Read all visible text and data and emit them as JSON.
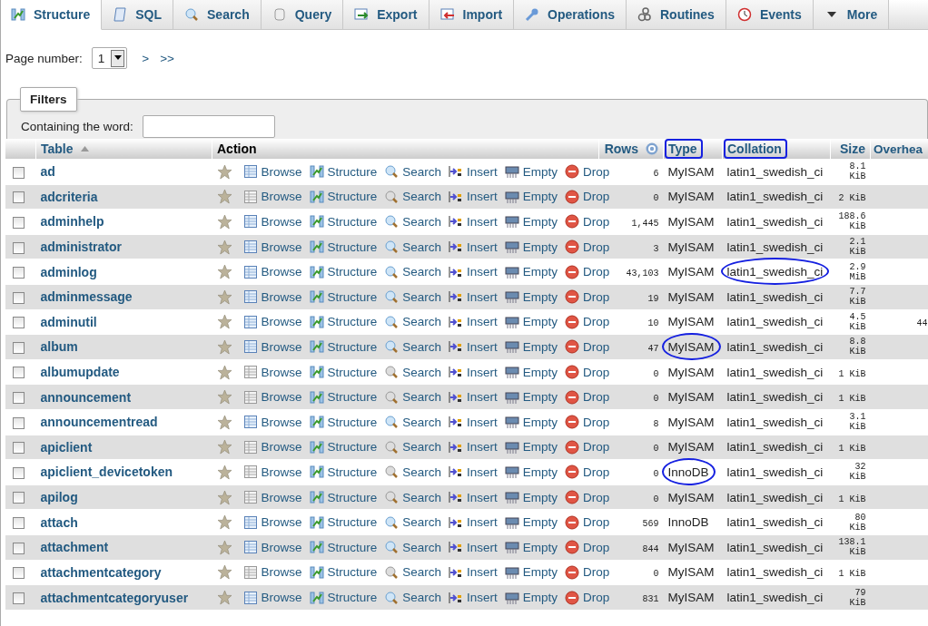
{
  "tabs": [
    {
      "label": "Structure",
      "selected": true
    },
    {
      "label": "SQL",
      "selected": false
    },
    {
      "label": "Search",
      "selected": false
    },
    {
      "label": "Query",
      "selected": false
    },
    {
      "label": "Export",
      "selected": false
    },
    {
      "label": "Import",
      "selected": false
    },
    {
      "label": "Operations",
      "selected": false
    },
    {
      "label": "Routines",
      "selected": false
    },
    {
      "label": "Events",
      "selected": false
    },
    {
      "label": "More",
      "selected": false
    }
  ],
  "pagination": {
    "label": "Page number:",
    "value": "1",
    "next": ">",
    "last": ">>"
  },
  "filters": {
    "legend": "Filters",
    "label": "Containing the word:"
  },
  "table": {
    "columns": [
      {
        "label": "Table",
        "circled": false
      },
      {
        "label": "Action",
        "circled": false
      },
      {
        "label": "Rows",
        "circled": false
      },
      {
        "label": "Type",
        "circled": true
      },
      {
        "label": "Collation",
        "circled": true
      },
      {
        "label": "Size",
        "circled": false
      },
      {
        "label": "Overhea",
        "circled": false
      }
    ],
    "rows": [
      {
        "name": "ad",
        "rows": "6",
        "type": "MyISAM",
        "collation": "latin1_swedish_ci",
        "size": "8.1 KiB",
        "checked": false,
        "empty": false,
        "actions": [
          "Browse",
          "Structure",
          "Search",
          "Insert",
          "Empty",
          "Drop"
        ]
      },
      {
        "name": "adcriteria",
        "rows": "0",
        "type": "MyISAM",
        "collation": "latin1_swedish_ci",
        "size": "2 KiB",
        "checked": false,
        "empty": true,
        "actions": [
          "Browse",
          "Structure",
          "Search",
          "Insert",
          "Empty",
          "Drop"
        ]
      },
      {
        "name": "adminhelp",
        "rows": "1,445",
        "type": "MyISAM",
        "collation": "latin1_swedish_ci",
        "size": "188.6 KiB",
        "checked": false,
        "empty": false,
        "actions": [
          "Browse",
          "Structure",
          "Search",
          "Insert",
          "Empty",
          "Drop"
        ]
      },
      {
        "name": "administrator",
        "rows": "3",
        "type": "MyISAM",
        "collation": "latin1_swedish_ci",
        "size": "2.1 KiB",
        "checked": false,
        "empty": false,
        "actions": [
          "Browse",
          "Structure",
          "Search",
          "Insert",
          "Empty",
          "Drop"
        ]
      },
      {
        "name": "adminlog",
        "rows": "43,103",
        "type": "MyISAM",
        "collation": "latin1_swedish_ci",
        "size": "2.9 MiB",
        "checked": false,
        "empty": false,
        "collation_circled": true,
        "actions": [
          "Browse",
          "Structure",
          "Search",
          "Insert",
          "Empty",
          "Drop"
        ]
      },
      {
        "name": "adminmessage",
        "rows": "19",
        "type": "MyISAM",
        "collation": "latin1_swedish_ci",
        "size": "7.7 KiB",
        "checked": false,
        "empty": false,
        "actions": [
          "Browse",
          "Structure",
          "Search",
          "Insert",
          "Empty",
          "Drop"
        ]
      },
      {
        "name": "adminutil",
        "rows": "10",
        "type": "MyISAM",
        "collation": "latin1_swedish_ci",
        "size": "4.5 KiB",
        "overhead": "44",
        "checked": false,
        "empty": false,
        "actions": [
          "Browse",
          "Structure",
          "Search",
          "Insert",
          "Empty",
          "Drop"
        ]
      },
      {
        "name": "album",
        "rows": "47",
        "type": "MyISAM",
        "collation": "latin1_swedish_ci",
        "size": "8.8 KiB",
        "checked": false,
        "empty": false,
        "type_circled": true,
        "actions": [
          "Browse",
          "Structure",
          "Search",
          "Insert",
          "Empty",
          "Drop"
        ]
      },
      {
        "name": "albumupdate",
        "rows": "0",
        "type": "MyISAM",
        "collation": "latin1_swedish_ci",
        "size": "1 KiB",
        "checked": false,
        "empty": true,
        "actions": [
          "Browse",
          "Structure",
          "Search",
          "Insert",
          "Empty",
          "Drop"
        ]
      },
      {
        "name": "announcement",
        "rows": "0",
        "type": "MyISAM",
        "collation": "latin1_swedish_ci",
        "size": "1 KiB",
        "checked": false,
        "empty": true,
        "actions": [
          "Browse",
          "Structure",
          "Search",
          "Insert",
          "Empty",
          "Drop"
        ]
      },
      {
        "name": "announcementread",
        "rows": "8",
        "type": "MyISAM",
        "collation": "latin1_swedish_ci",
        "size": "3.1 KiB",
        "checked": false,
        "empty": false,
        "actions": [
          "Browse",
          "Structure",
          "Search",
          "Insert",
          "Empty",
          "Drop"
        ]
      },
      {
        "name": "apiclient",
        "rows": "0",
        "type": "MyISAM",
        "collation": "latin1_swedish_ci",
        "size": "1 KiB",
        "checked": false,
        "empty": true,
        "actions": [
          "Browse",
          "Structure",
          "Search",
          "Insert",
          "Empty",
          "Drop"
        ]
      },
      {
        "name": "apiclient_devicetoken",
        "rows": "0",
        "type": "InnoDB",
        "collation": "latin1_swedish_ci",
        "size": "32 KiB",
        "checked": false,
        "empty": true,
        "type_circled": true,
        "actions": [
          "Browse",
          "Structure",
          "Search",
          "Insert",
          "Empty",
          "Drop"
        ]
      },
      {
        "name": "apilog",
        "rows": "0",
        "type": "MyISAM",
        "collation": "latin1_swedish_ci",
        "size": "1 KiB",
        "checked": false,
        "empty": true,
        "actions": [
          "Browse",
          "Structure",
          "Search",
          "Insert",
          "Empty",
          "Drop"
        ]
      },
      {
        "name": "attach",
        "rows": "569",
        "type": "InnoDB",
        "collation": "latin1_swedish_ci",
        "size": "80 KiB",
        "checked": false,
        "empty": false,
        "actions": [
          "Browse",
          "Structure",
          "Search",
          "Insert",
          "Empty",
          "Drop"
        ]
      },
      {
        "name": "attachment",
        "rows": "844",
        "type": "MyISAM",
        "collation": "latin1_swedish_ci",
        "size": "138.1 KiB",
        "checked": false,
        "empty": false,
        "actions": [
          "Browse",
          "Structure",
          "Search",
          "Insert",
          "Empty",
          "Drop"
        ]
      },
      {
        "name": "attachmentcategory",
        "rows": "0",
        "type": "MyISAM",
        "collation": "latin1_swedish_ci",
        "size": "1 KiB",
        "checked": false,
        "empty": true,
        "actions": [
          "Browse",
          "Structure",
          "Search",
          "Insert",
          "Empty",
          "Drop"
        ]
      },
      {
        "name": "attachmentcategoryuser",
        "rows": "831",
        "type": "MyISAM",
        "collation": "latin1_swedish_ci",
        "size": "79 KiB",
        "checked": false,
        "empty": false,
        "actions": [
          "Browse",
          "Structure",
          "Search",
          "Insert",
          "Empty",
          "Drop"
        ]
      }
    ]
  }
}
